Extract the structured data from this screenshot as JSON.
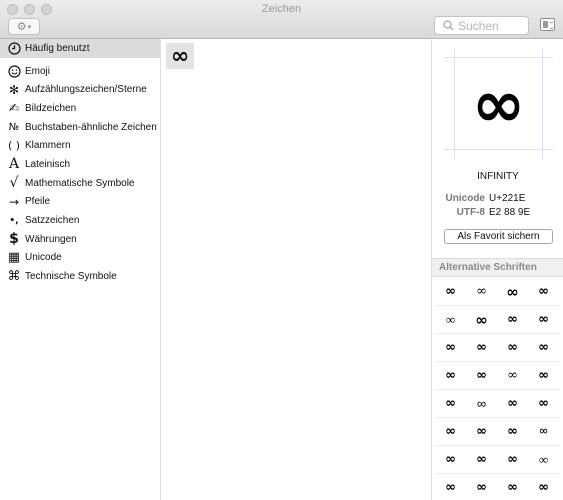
{
  "window": {
    "title": "Zeichen"
  },
  "toolbar": {
    "gear_icon": "gear-icon",
    "search_placeholder": "Suchen"
  },
  "sidebar": {
    "items": [
      {
        "label": "Häufig benutzt",
        "icon": "clock-icon",
        "glyph": "🕘",
        "selected": true
      },
      {
        "label": "Emoji",
        "icon": "smiley-icon",
        "glyph": "☺"
      },
      {
        "label": "Aufzählungszeichen/Sterne",
        "icon": "asterisk-icon",
        "glyph": "✻"
      },
      {
        "label": "Bildzeichen",
        "icon": "pencil-icon",
        "glyph": "✍"
      },
      {
        "label": "Buchstaben-ähnliche Zeichen",
        "icon": "numero-icon",
        "glyph": "№"
      },
      {
        "label": "Klammern",
        "icon": "parentheses-icon",
        "glyph": "( )"
      },
      {
        "label": "Lateinisch",
        "icon": "letter-a-icon",
        "glyph": "A"
      },
      {
        "label": "Mathematische Symbole",
        "icon": "square-root-icon",
        "glyph": "√"
      },
      {
        "label": "Pfeile",
        "icon": "arrow-right-icon",
        "glyph": "→"
      },
      {
        "label": "Satzzeichen",
        "icon": "punctuation-icon",
        "glyph": "•,"
      },
      {
        "label": "Währungen",
        "icon": "dollar-icon",
        "glyph": "$"
      },
      {
        "label": "Unicode",
        "icon": "unicode-grid-icon",
        "glyph": "▦"
      },
      {
        "label": "Technische Symbole",
        "icon": "command-icon",
        "glyph": "⌘"
      }
    ]
  },
  "main": {
    "characters": [
      "∞"
    ]
  },
  "inspector": {
    "glyph": "∞",
    "name": "INFINITY",
    "unicode_label": "Unicode",
    "unicode_value": "U+221E",
    "utf8_label": "UTF-8",
    "utf8_value": "E2 88 9E",
    "favorite_button": "Als Favorit sichern",
    "alt_fonts_header": "Alternative Schriften",
    "alt_glyph": "∞"
  }
}
